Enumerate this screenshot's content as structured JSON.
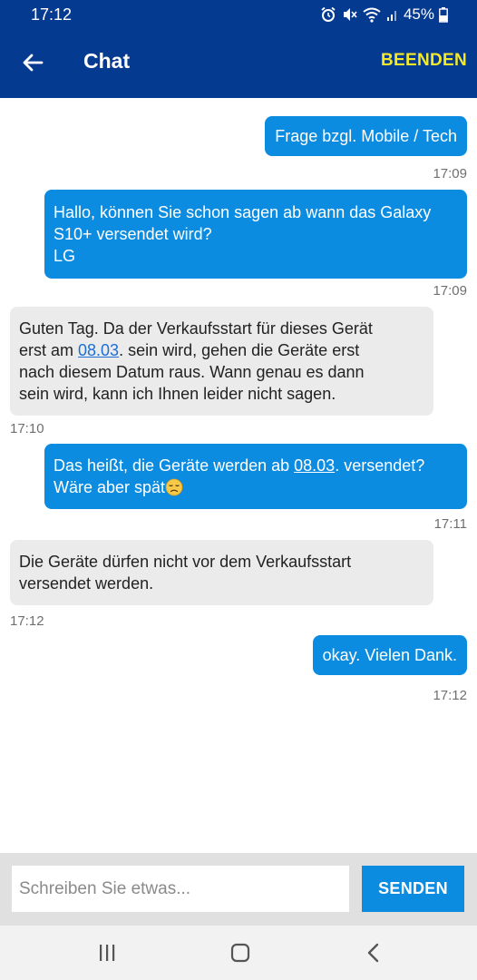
{
  "status": {
    "time": "17:12",
    "battery": "45%"
  },
  "appbar": {
    "title": "Chat",
    "end_label": "BEENDEN"
  },
  "messages": [
    {
      "dir": "out",
      "text": "Frage bzgl. Mobile / Tech",
      "time": "17:09"
    },
    {
      "dir": "out",
      "text": "Hallo, können Sie schon sagen ab wann das Galaxy\nS10+ versendet wird?\nLG",
      "time": "17:09"
    },
    {
      "dir": "in",
      "pre": "Guten Tag. Da der Verkaufsstart für dieses Gerät\nerst am ",
      "link": "08.03",
      "post": ". sein wird, gehen die Geräte erst\nnach diesem Datum raus. Wann genau es dann\nsein wird, kann ich Ihnen leider nicht sagen.",
      "time": "17:10"
    },
    {
      "dir": "out",
      "pre": "Das heißt, die Geräte werden ab ",
      "link": "08.03",
      "post": ". versendet?\nWäre aber spät",
      "emoji": "disappointed-face",
      "time": "17:11"
    },
    {
      "dir": "in",
      "text": "Die Geräte dürfen nicht vor dem Verkaufsstart\nversendet werden.",
      "time": "17:12"
    },
    {
      "dir": "out",
      "text": "okay. Vielen Dank.",
      "time": "17:12"
    }
  ],
  "composer": {
    "placeholder": "Schreiben Sie etwas...",
    "send_label": "SENDEN"
  },
  "colors": {
    "header": "#053a91",
    "accent": "#0c8ce0",
    "end_button": "#f5e829",
    "incoming_bubble": "#ebebeb"
  },
  "icons": [
    "back-arrow-icon",
    "alarm-icon",
    "mute-icon",
    "wifi-icon",
    "signal-icon",
    "battery-icon",
    "recents-icon",
    "home-icon",
    "nav-back-icon"
  ]
}
